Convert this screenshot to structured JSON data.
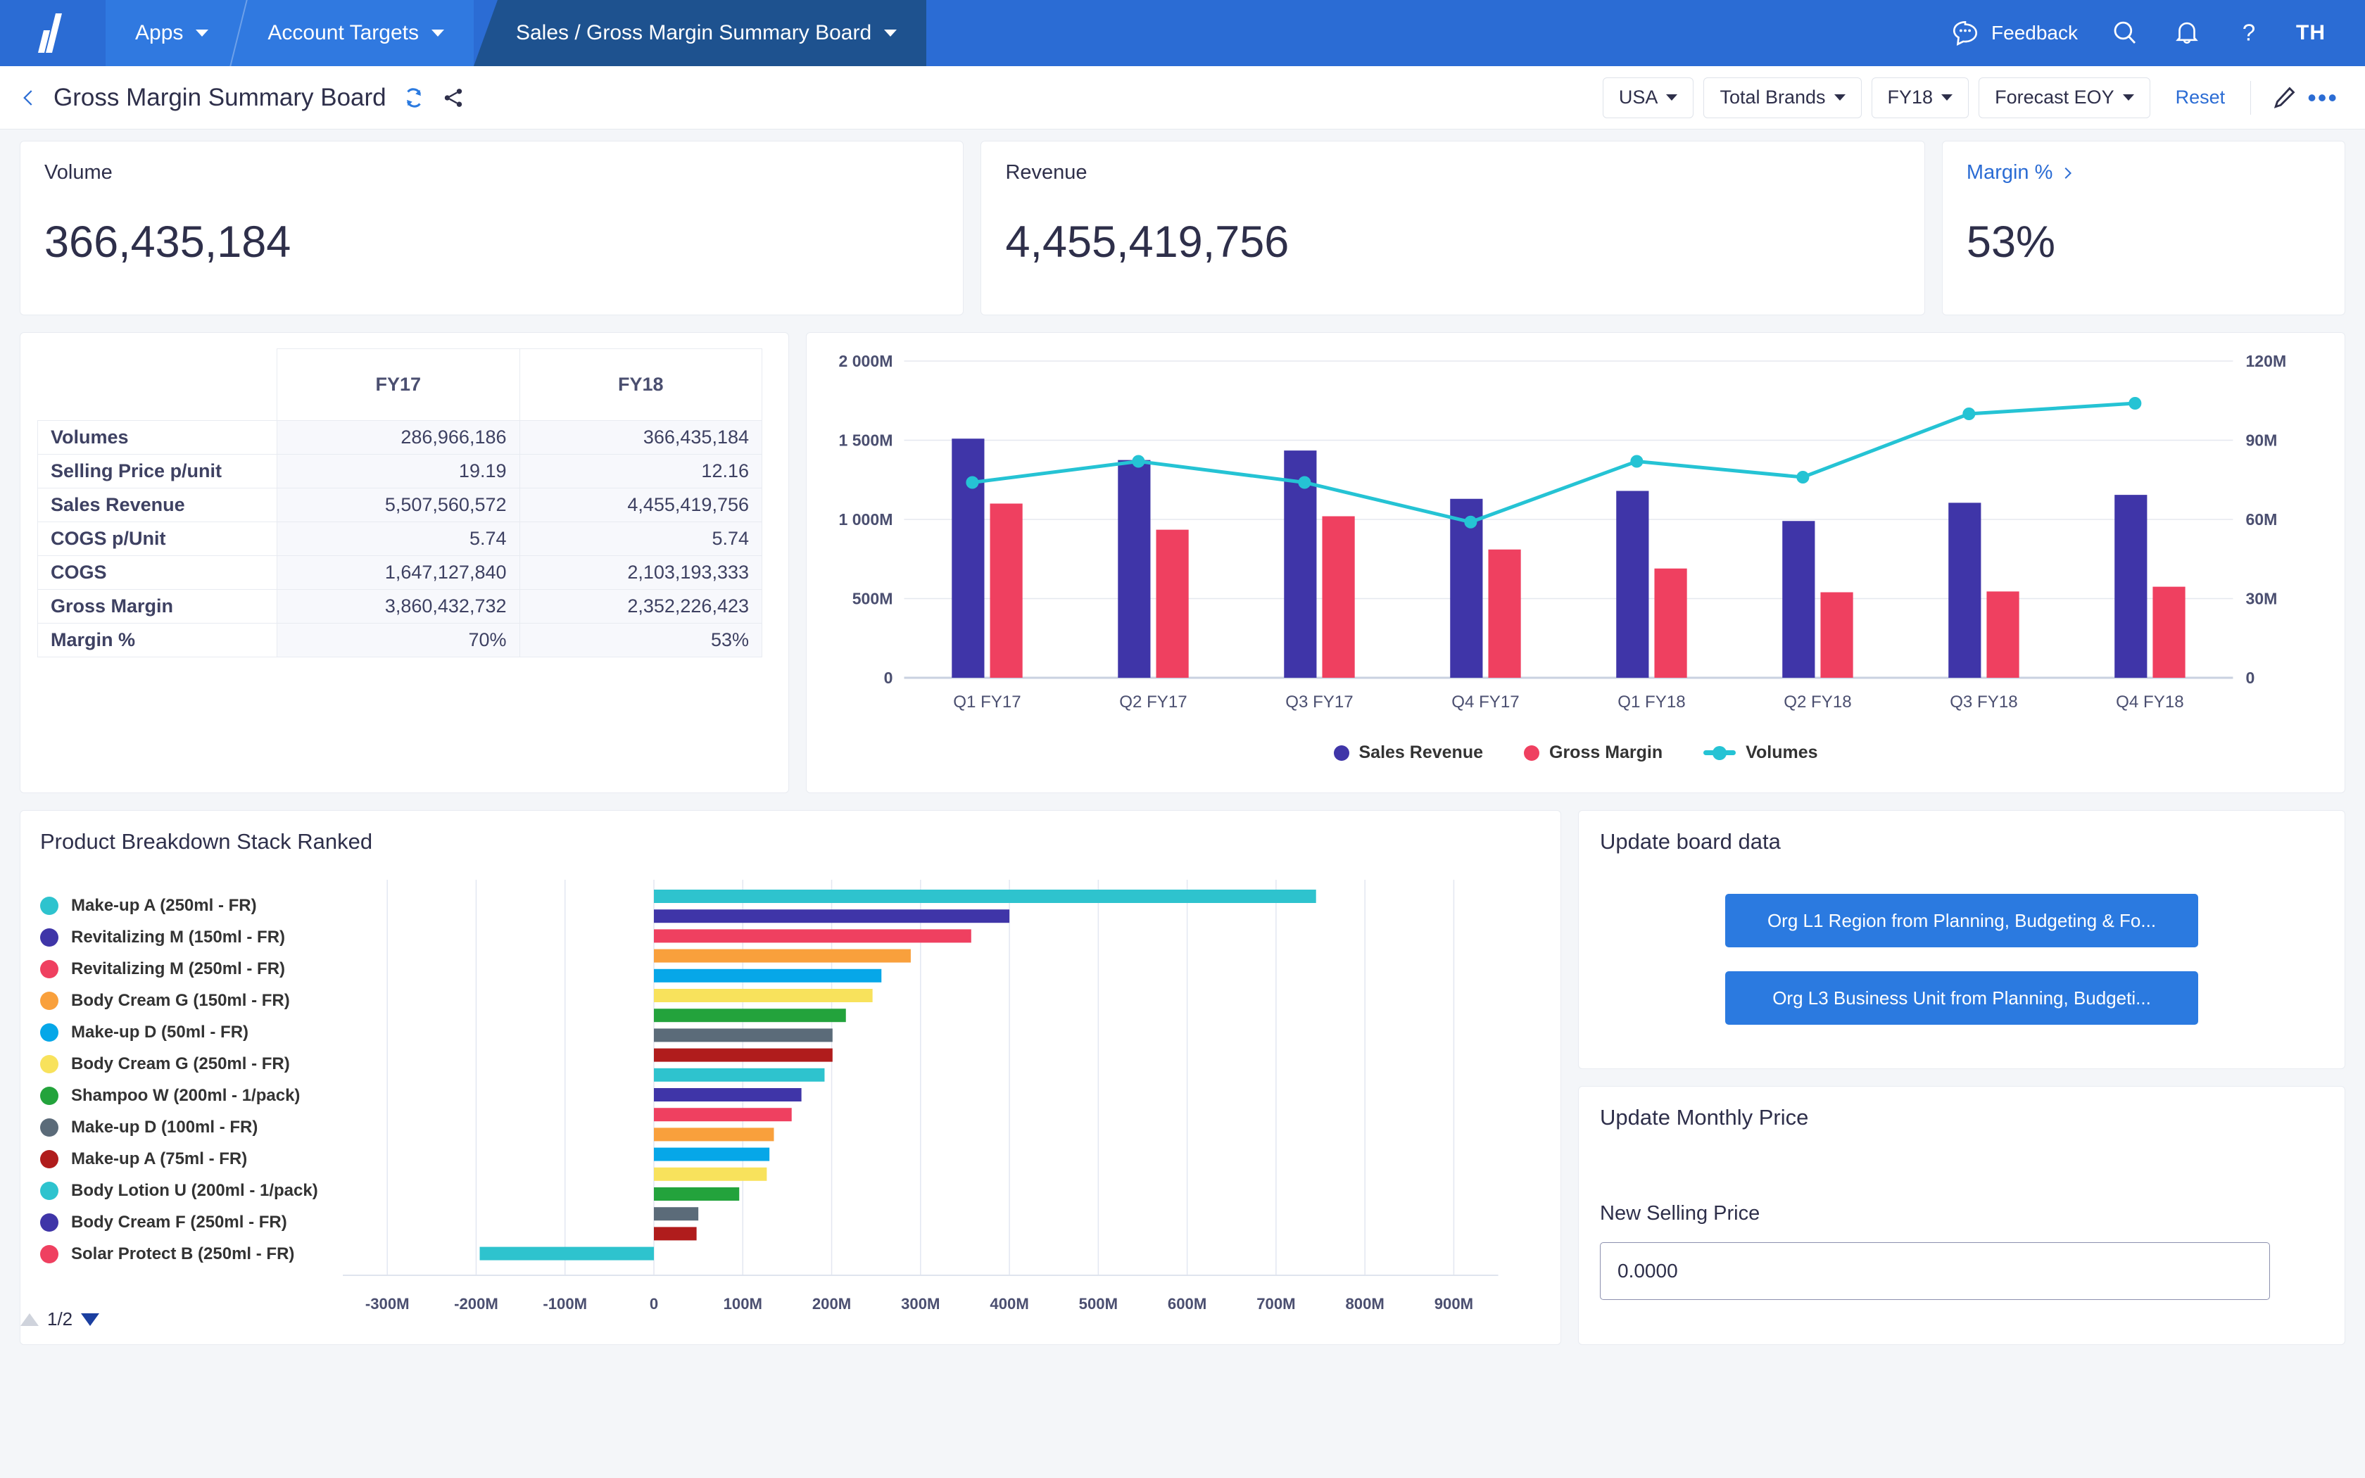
{
  "topnav": {
    "logo": "anaplan-logo-icon",
    "tabs": [
      {
        "label": "Apps",
        "icon": "chevron-down-icon"
      },
      {
        "label": "Account Targets",
        "icon": "chevron-down-icon"
      },
      {
        "label": "Sales / Gross Margin Summary Board",
        "icon": "chevron-down-icon"
      }
    ],
    "feedback_label": "Feedback",
    "icons": [
      "speech-bubble-icon",
      "search-icon",
      "bell-icon",
      "help-icon"
    ],
    "avatar_initials": "TH"
  },
  "boardbar": {
    "back_icon": "chevron-left-icon",
    "title": "Gross Margin Summary Board",
    "refresh_icon": "refresh-icon",
    "share_icon": "share-icon",
    "filters": [
      {
        "label": "USA"
      },
      {
        "label": "Total Brands"
      },
      {
        "label": "FY18"
      },
      {
        "label": "Forecast EOY"
      }
    ],
    "reset_label": "Reset",
    "edit_icon": "pencil-icon",
    "more_icon": "kebab-menu-icon"
  },
  "kpis": [
    {
      "label": "Volume",
      "value": "366,435,184",
      "is_link": false
    },
    {
      "label": "Revenue",
      "value": "4,455,419,756",
      "is_link": false
    },
    {
      "label": "Margin %",
      "value": "53%",
      "is_link": true
    }
  ],
  "table": {
    "columns": [
      "",
      "FY17",
      "FY18"
    ],
    "rows": [
      {
        "label": "Volumes",
        "fy17": "286,966,186",
        "fy18": "366,435,184"
      },
      {
        "label": "Selling Price p/unit",
        "fy17": "19.19",
        "fy18": "12.16"
      },
      {
        "label": "Sales Revenue",
        "fy17": "5,507,560,572",
        "fy18": "4,455,419,756"
      },
      {
        "label": "COGS p/Unit",
        "fy17": "5.74",
        "fy18": "5.74"
      },
      {
        "label": "COGS",
        "fy17": "1,647,127,840",
        "fy18": "2,103,193,333"
      },
      {
        "label": "Gross Margin",
        "fy17": "3,860,432,732",
        "fy18": "2,352,226,423"
      },
      {
        "label": "Margin %",
        "fy17": "70%",
        "fy18": "53%"
      }
    ]
  },
  "chart_data": [
    {
      "id": "combo",
      "type": "bar",
      "title": "",
      "categories": [
        "Q1 FY17",
        "Q2 FY17",
        "Q3 FY17",
        "Q4 FY17",
        "Q1 FY18",
        "Q2 FY18",
        "Q3 FY18",
        "Q4 FY18"
      ],
      "series": [
        {
          "name": "Sales Revenue",
          "type": "bar",
          "axis": "left",
          "color": "#3f35a8",
          "values": [
            1510,
            1375,
            1435,
            1130,
            1180,
            990,
            1105,
            1155
          ]
        },
        {
          "name": "Gross Margin",
          "type": "bar",
          "axis": "left",
          "color": "#ef4060",
          "values": [
            1100,
            935,
            1020,
            810,
            690,
            540,
            545,
            575
          ]
        },
        {
          "name": "Volumes",
          "type": "line",
          "axis": "right",
          "color": "#25c3d4",
          "values": [
            74,
            82,
            74,
            59,
            82,
            76,
            100,
            104
          ]
        }
      ],
      "ylabel": "",
      "xlabel": "",
      "ytick_labels_left": [
        "0",
        "500M",
        "1 000M",
        "1 500M",
        "2 000M"
      ],
      "ylim_left": [
        0,
        2000
      ],
      "ytick_labels_right": [
        "0",
        "30M",
        "60M",
        "90M",
        "120M"
      ],
      "ylim_right": [
        0,
        120
      ],
      "grid": true,
      "legend_position": "bottom",
      "legend": [
        "Sales Revenue",
        "Gross Margin",
        "Volumes"
      ]
    },
    {
      "id": "product-breakdown",
      "type": "bar",
      "orientation": "horizontal",
      "title": "Product Breakdown Stack Ranked",
      "xlabel": "",
      "ylabel": "",
      "xtick_labels": [
        "-300M",
        "-200M",
        "-100M",
        "0",
        "100M",
        "200M",
        "300M",
        "400M",
        "500M",
        "600M",
        "700M",
        "800M",
        "900M"
      ],
      "xlim": [
        -350,
        950
      ],
      "grid": true,
      "legend_position": "left",
      "pagination": "1/2",
      "categories": [
        "Make-up A (250ml - FR)",
        "Revitalizing M (150ml - FR)",
        "Revitalizing M (250ml - FR)",
        "Body Cream G (150ml - FR)",
        "Make-up D (50ml - FR)",
        "Body Cream G (250ml - FR)",
        "Shampoo W (200ml - 1/pack)",
        "Make-up D (100ml - FR)",
        "Make-up A (75ml - FR)",
        "Body Lotion U (200ml - 1/pack)",
        "Body Cream F (250ml - FR)",
        "Solar Protect B (250ml - FR)",
        "Body Cream G (150ml - FR) ",
        "Make-up D (50ml - FR) ",
        "Body Cream G (250ml - FR) ",
        "Shampoo W (200ml - 1/pack) ",
        "Make-up D (100ml - FR) ",
        "Make-up A (75ml - FR) ",
        "Body Lotion U (200ml - 1/pack) "
      ],
      "values": [
        745,
        400,
        357,
        289,
        256,
        246,
        216,
        201,
        201,
        192,
        166,
        155,
        135,
        130,
        127,
        96,
        50,
        48,
        -196
      ],
      "colors": [
        "#2ec3ce",
        "#3f35a8",
        "#ef4060",
        "#f9a03c",
        "#06a7e8",
        "#f8e25c",
        "#23a33c",
        "#5b6b79",
        "#b01c1c",
        "#2ec3ce",
        "#3f35a8",
        "#ef4060",
        "#f9a03c",
        "#06a7e8",
        "#f8e25c",
        "#23a33c",
        "#5b6b79",
        "#b01c1c",
        "#2ec3ce"
      ],
      "legend_items": [
        {
          "label": "Make-up A (250ml - FR)",
          "color": "#2ec3ce"
        },
        {
          "label": "Revitalizing M (150ml - FR)",
          "color": "#3f35a8"
        },
        {
          "label": "Revitalizing M (250ml - FR)",
          "color": "#ef4060"
        },
        {
          "label": "Body Cream G (150ml - FR)",
          "color": "#f9a03c"
        },
        {
          "label": "Make-up D (50ml - FR)",
          "color": "#06a7e8"
        },
        {
          "label": "Body Cream G (250ml - FR)",
          "color": "#f8e25c"
        },
        {
          "label": "Shampoo W (200ml - 1/pack)",
          "color": "#23a33c"
        },
        {
          "label": "Make-up D (100ml - FR)",
          "color": "#5b6b79"
        },
        {
          "label": "Make-up A (75ml - FR)",
          "color": "#b01c1c"
        },
        {
          "label": "Body Lotion U (200ml - 1/pack)",
          "color": "#2ec3ce"
        },
        {
          "label": "Body Cream F (250ml - FR)",
          "color": "#3f35a8"
        },
        {
          "label": "Solar Protect B (250ml - FR)",
          "color": "#ef4060"
        }
      ]
    }
  ],
  "update_board": {
    "title": "Update board data",
    "buttons": [
      "Org L1 Region from Planning, Budgeting & Fo...",
      "Org L3 Business Unit from Planning, Budgeti..."
    ]
  },
  "update_price": {
    "title": "Update Monthly Price",
    "field_label": "New Selling Price",
    "value": "0.0000",
    "placeholder": "0.0000"
  },
  "colors": {
    "brand_blue": "#2b6cd4",
    "accent_blue": "#2b7ae0",
    "series_revenue": "#3f35a8",
    "series_margin": "#ef4060",
    "series_volume": "#25c3d4",
    "text_dark": "#2e2f4a"
  }
}
